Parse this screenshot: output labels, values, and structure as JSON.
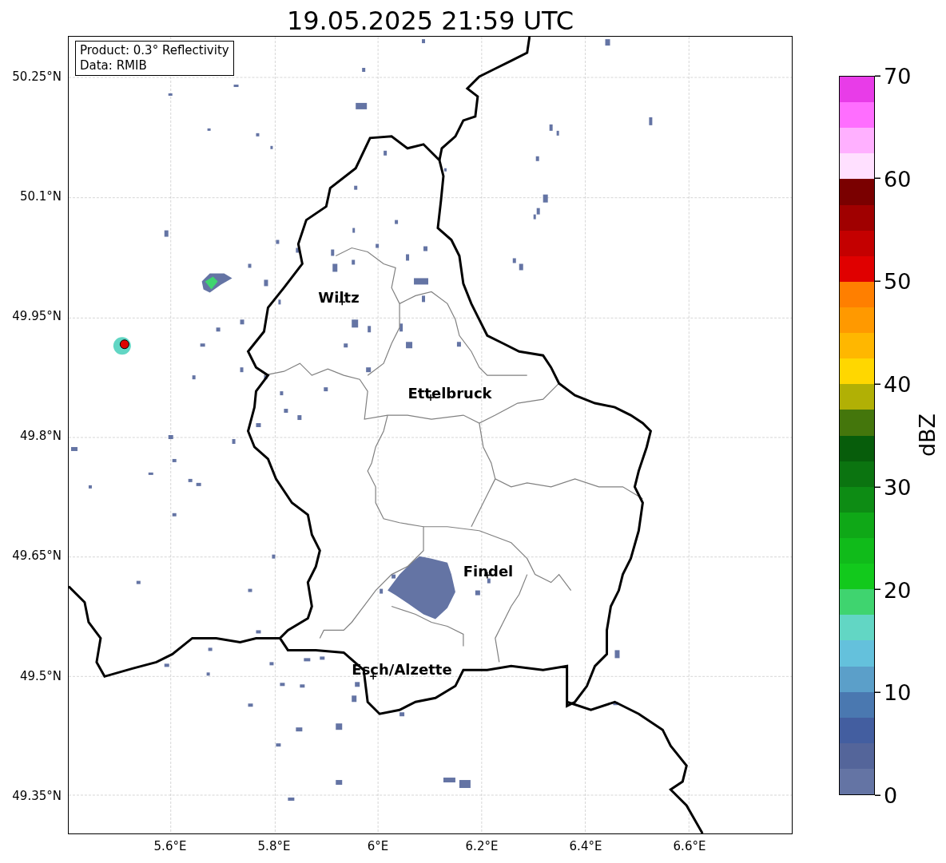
{
  "title": "19.05.2025 21:59 UTC",
  "info_box": {
    "lines": [
      "Product: 0.3° Reflectivity",
      "Data: RMIB"
    ]
  },
  "map": {
    "cities": [
      {
        "name": "Wiltz"
      },
      {
        "name": "Ettelbruck"
      },
      {
        "name": "Findel"
      },
      {
        "name": "Esch/Alzette"
      }
    ]
  },
  "y_ticks": [
    "50.25°N",
    "50.1°N",
    "49.95°N",
    "49.8°N",
    "49.65°N",
    "49.5°N",
    "49.35°N"
  ],
  "x_ticks": [
    "5.6°E",
    "5.8°E",
    "6°E",
    "6.2°E",
    "6.4°E",
    "6.6°E"
  ],
  "colorbar": {
    "label": "dBZ",
    "ticks": [
      "70",
      "60",
      "50",
      "40",
      "30",
      "20",
      "10",
      "0"
    ],
    "bins": [
      {
        "color": "#e83ce8"
      },
      {
        "color": "#ff6eff"
      },
      {
        "color": "#ffb0ff"
      },
      {
        "color": "#ffe0ff"
      },
      {
        "color": "#7a0000"
      },
      {
        "color": "#a00000"
      },
      {
        "color": "#c40000"
      },
      {
        "color": "#e00000"
      },
      {
        "color": "#ff7f00"
      },
      {
        "color": "#ff9900"
      },
      {
        "color": "#ffb700"
      },
      {
        "color": "#ffd700"
      },
      {
        "color": "#b1b005"
      },
      {
        "color": "#44760c"
      },
      {
        "color": "#075d0b"
      },
      {
        "color": "#0b7410"
      },
      {
        "color": "#0d8c14"
      },
      {
        "color": "#0fa817"
      },
      {
        "color": "#10bb1a"
      },
      {
        "color": "#12c91c"
      },
      {
        "color": "#3fd46f"
      },
      {
        "color": "#62d6c4"
      },
      {
        "color": "#64c1dc"
      },
      {
        "color": "#5b9fc9"
      },
      {
        "color": "#4a78b0"
      },
      {
        "color": "#435ea0"
      },
      {
        "color": "#54659a"
      },
      {
        "color": "#6474a4"
      }
    ]
  }
}
